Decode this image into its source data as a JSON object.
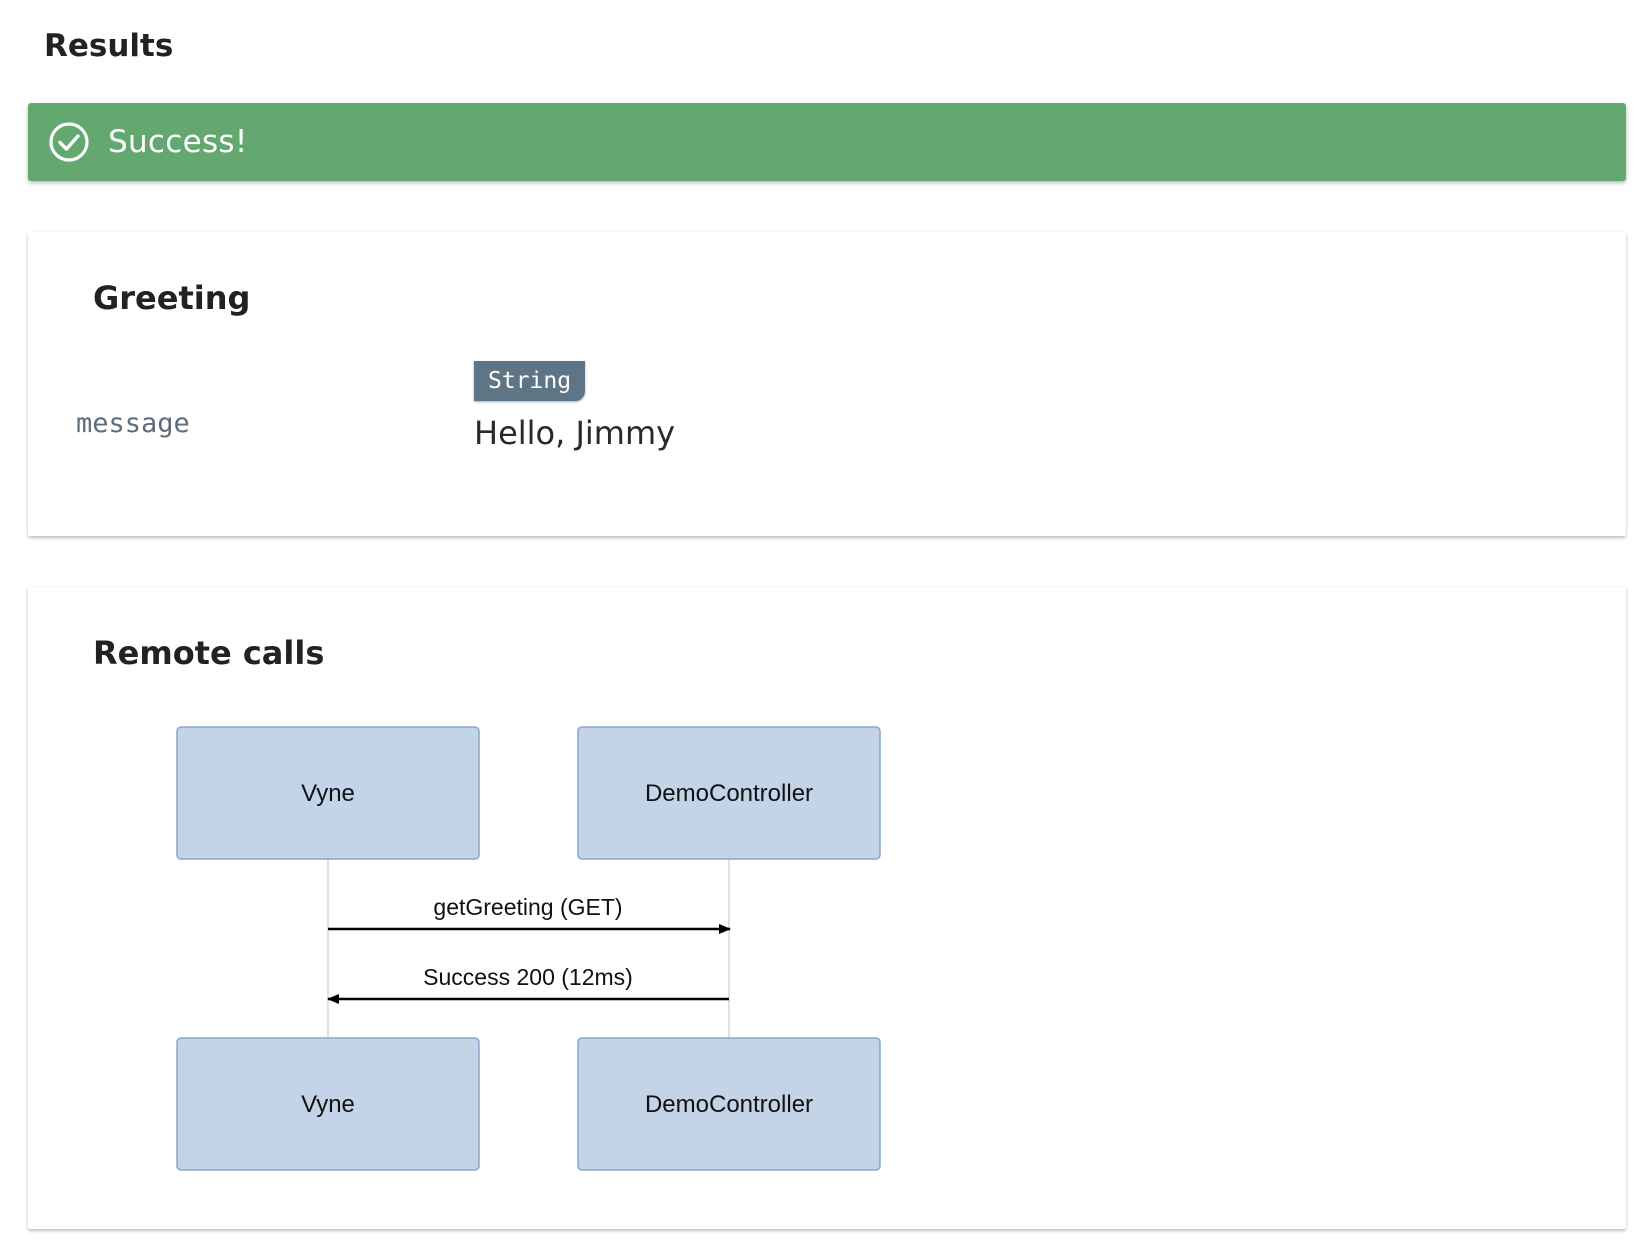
{
  "page": {
    "title": "Results"
  },
  "banner": {
    "text": "Success!",
    "icon": "check-circle-icon",
    "color": "#63a86e"
  },
  "greeting": {
    "title": "Greeting",
    "field": {
      "name": "message",
      "type": "String",
      "value": "Hello, Jimmy"
    }
  },
  "remote_calls": {
    "title": "Remote calls",
    "participants": [
      "Vyne",
      "DemoController"
    ],
    "messages": [
      {
        "from": "Vyne",
        "to": "DemoController",
        "label": "getGreeting (GET)"
      },
      {
        "from": "DemoController",
        "to": "Vyne",
        "label": "Success 200 (12ms)"
      }
    ]
  }
}
